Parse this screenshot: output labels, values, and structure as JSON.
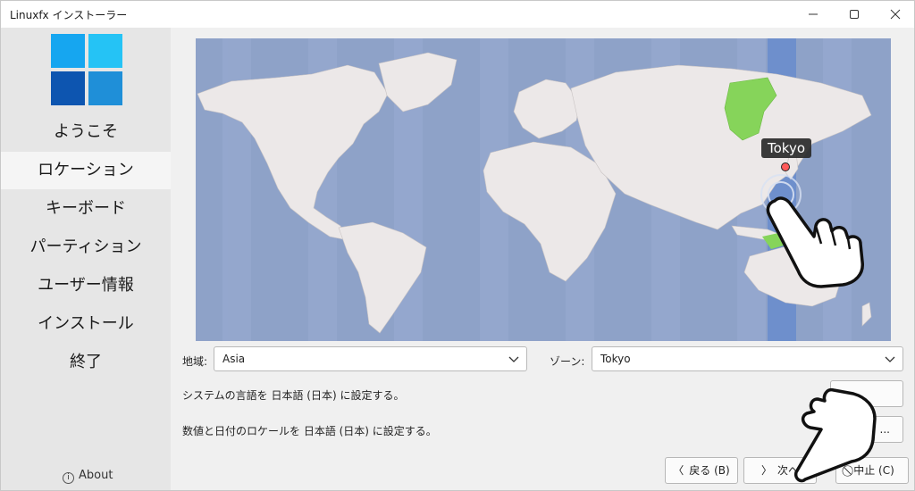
{
  "window": {
    "title": "Linuxfx インストーラー"
  },
  "sidebar": {
    "items": [
      {
        "label": "ようこそ"
      },
      {
        "label": "ロケーション"
      },
      {
        "label": "キーボード"
      },
      {
        "label": "パーティション"
      },
      {
        "label": "ユーザー情報"
      },
      {
        "label": "インストール"
      },
      {
        "label": "終了"
      }
    ],
    "active_index": 1,
    "about_label": "About"
  },
  "map": {
    "selected_city": "Tokyo",
    "colors": {
      "ocean": "#8ea2c8",
      "land": "#ece8e8",
      "highlight": "#86d45a",
      "band": "#6e8fcc"
    }
  },
  "location": {
    "region_label": "地域:",
    "region_value": "Asia",
    "zone_label": "ゾーン:",
    "zone_value": "Tokyo",
    "system_language_text": "システムの言語を 日本語 (日本) に設定する。",
    "locale_text": "数値と日付のロケールを 日本語 (日本) に設定する。",
    "change_button_1": "",
    "change_button_2": "..."
  },
  "footer": {
    "back_label": "戻る (B)",
    "next_label": "次へ",
    "cancel_label": "中止 (C)"
  }
}
